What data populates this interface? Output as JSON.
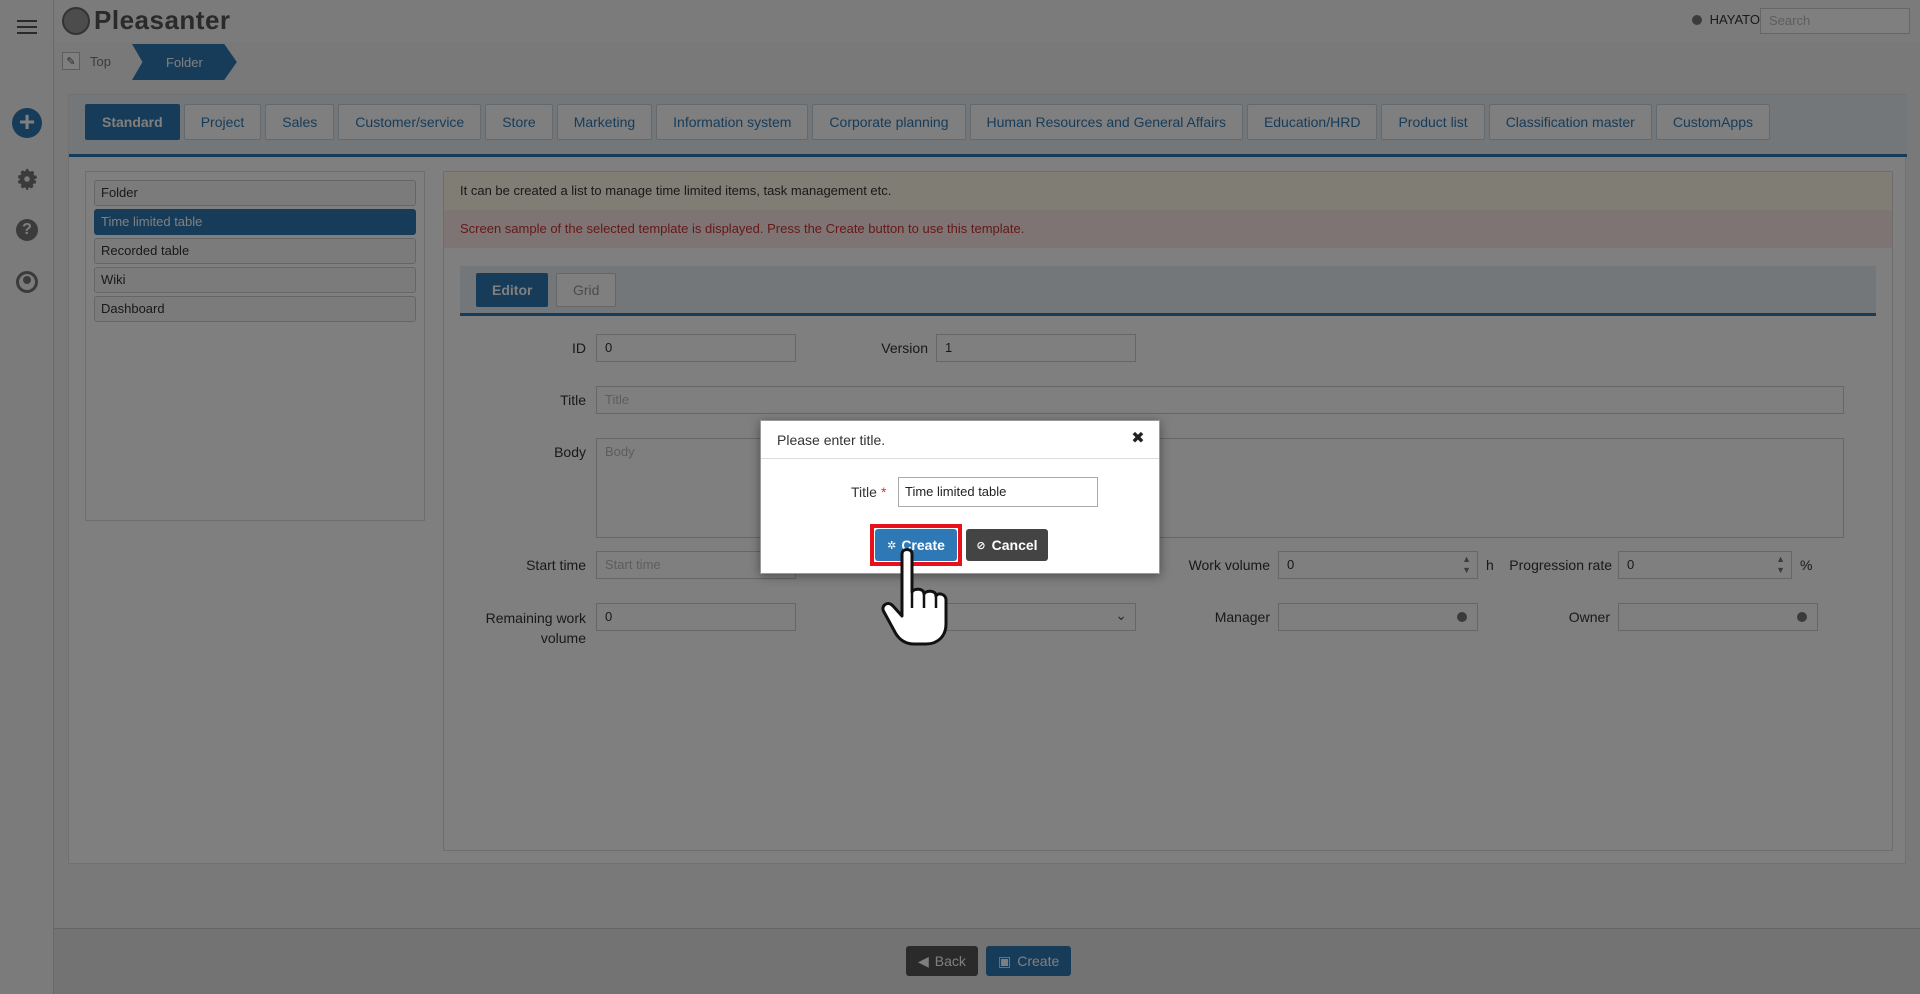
{
  "header": {
    "logo_text": "Pleasanter",
    "user_name": "HAYATO",
    "search_placeholder": "Search"
  },
  "breadcrumb": [
    {
      "label": "Top"
    },
    {
      "label": "Folder"
    }
  ],
  "category_tabs": [
    {
      "label": "Standard",
      "active": true
    },
    {
      "label": "Project"
    },
    {
      "label": "Sales"
    },
    {
      "label": "Customer/service"
    },
    {
      "label": "Store"
    },
    {
      "label": "Marketing"
    },
    {
      "label": "Information system"
    },
    {
      "label": "Corporate planning"
    },
    {
      "label": "Human Resources and General Affairs"
    },
    {
      "label": "Education/HRD"
    },
    {
      "label": "Product list"
    },
    {
      "label": "Classification master"
    },
    {
      "label": "CustomApps"
    }
  ],
  "template_list": [
    {
      "label": "Folder"
    },
    {
      "label": "Time limited table",
      "selected": true
    },
    {
      "label": "Recorded table"
    },
    {
      "label": "Wiki"
    },
    {
      "label": "Dashboard"
    }
  ],
  "preview": {
    "description": "It can be created a list to manage time limited items, task management etc.",
    "notice": "Screen sample of the selected template is displayed. Press the Create button to use this template.",
    "tabs": {
      "editor": "Editor",
      "grid": "Grid"
    },
    "fields": {
      "id_label": "ID",
      "id_value": "0",
      "version_label": "Version",
      "version_value": "1",
      "title_label": "Title",
      "title_placeholder": "Title",
      "body_label": "Body",
      "body_placeholder": "Body",
      "start_label": "Start time",
      "start_placeholder": "Start time",
      "work_volume_label": "Work volume",
      "work_volume_value": "0",
      "work_volume_unit": "h",
      "progress_label": "Progression rate",
      "progress_value": "0",
      "progress_unit": "%",
      "remaining_label": "Remaining work volume",
      "remaining_value": "0",
      "manager_label": "Manager",
      "owner_label": "Owner"
    }
  },
  "footer": {
    "back_label": "Back",
    "create_label": "Create"
  },
  "dialog": {
    "heading": "Please enter title.",
    "title_label": "Title",
    "required_mark": "*",
    "title_value": "Time limited table",
    "create_label": "Create",
    "cancel_label": "Cancel"
  },
  "colors": {
    "accent": "#2e79b5",
    "highlight": "#e8101a"
  }
}
